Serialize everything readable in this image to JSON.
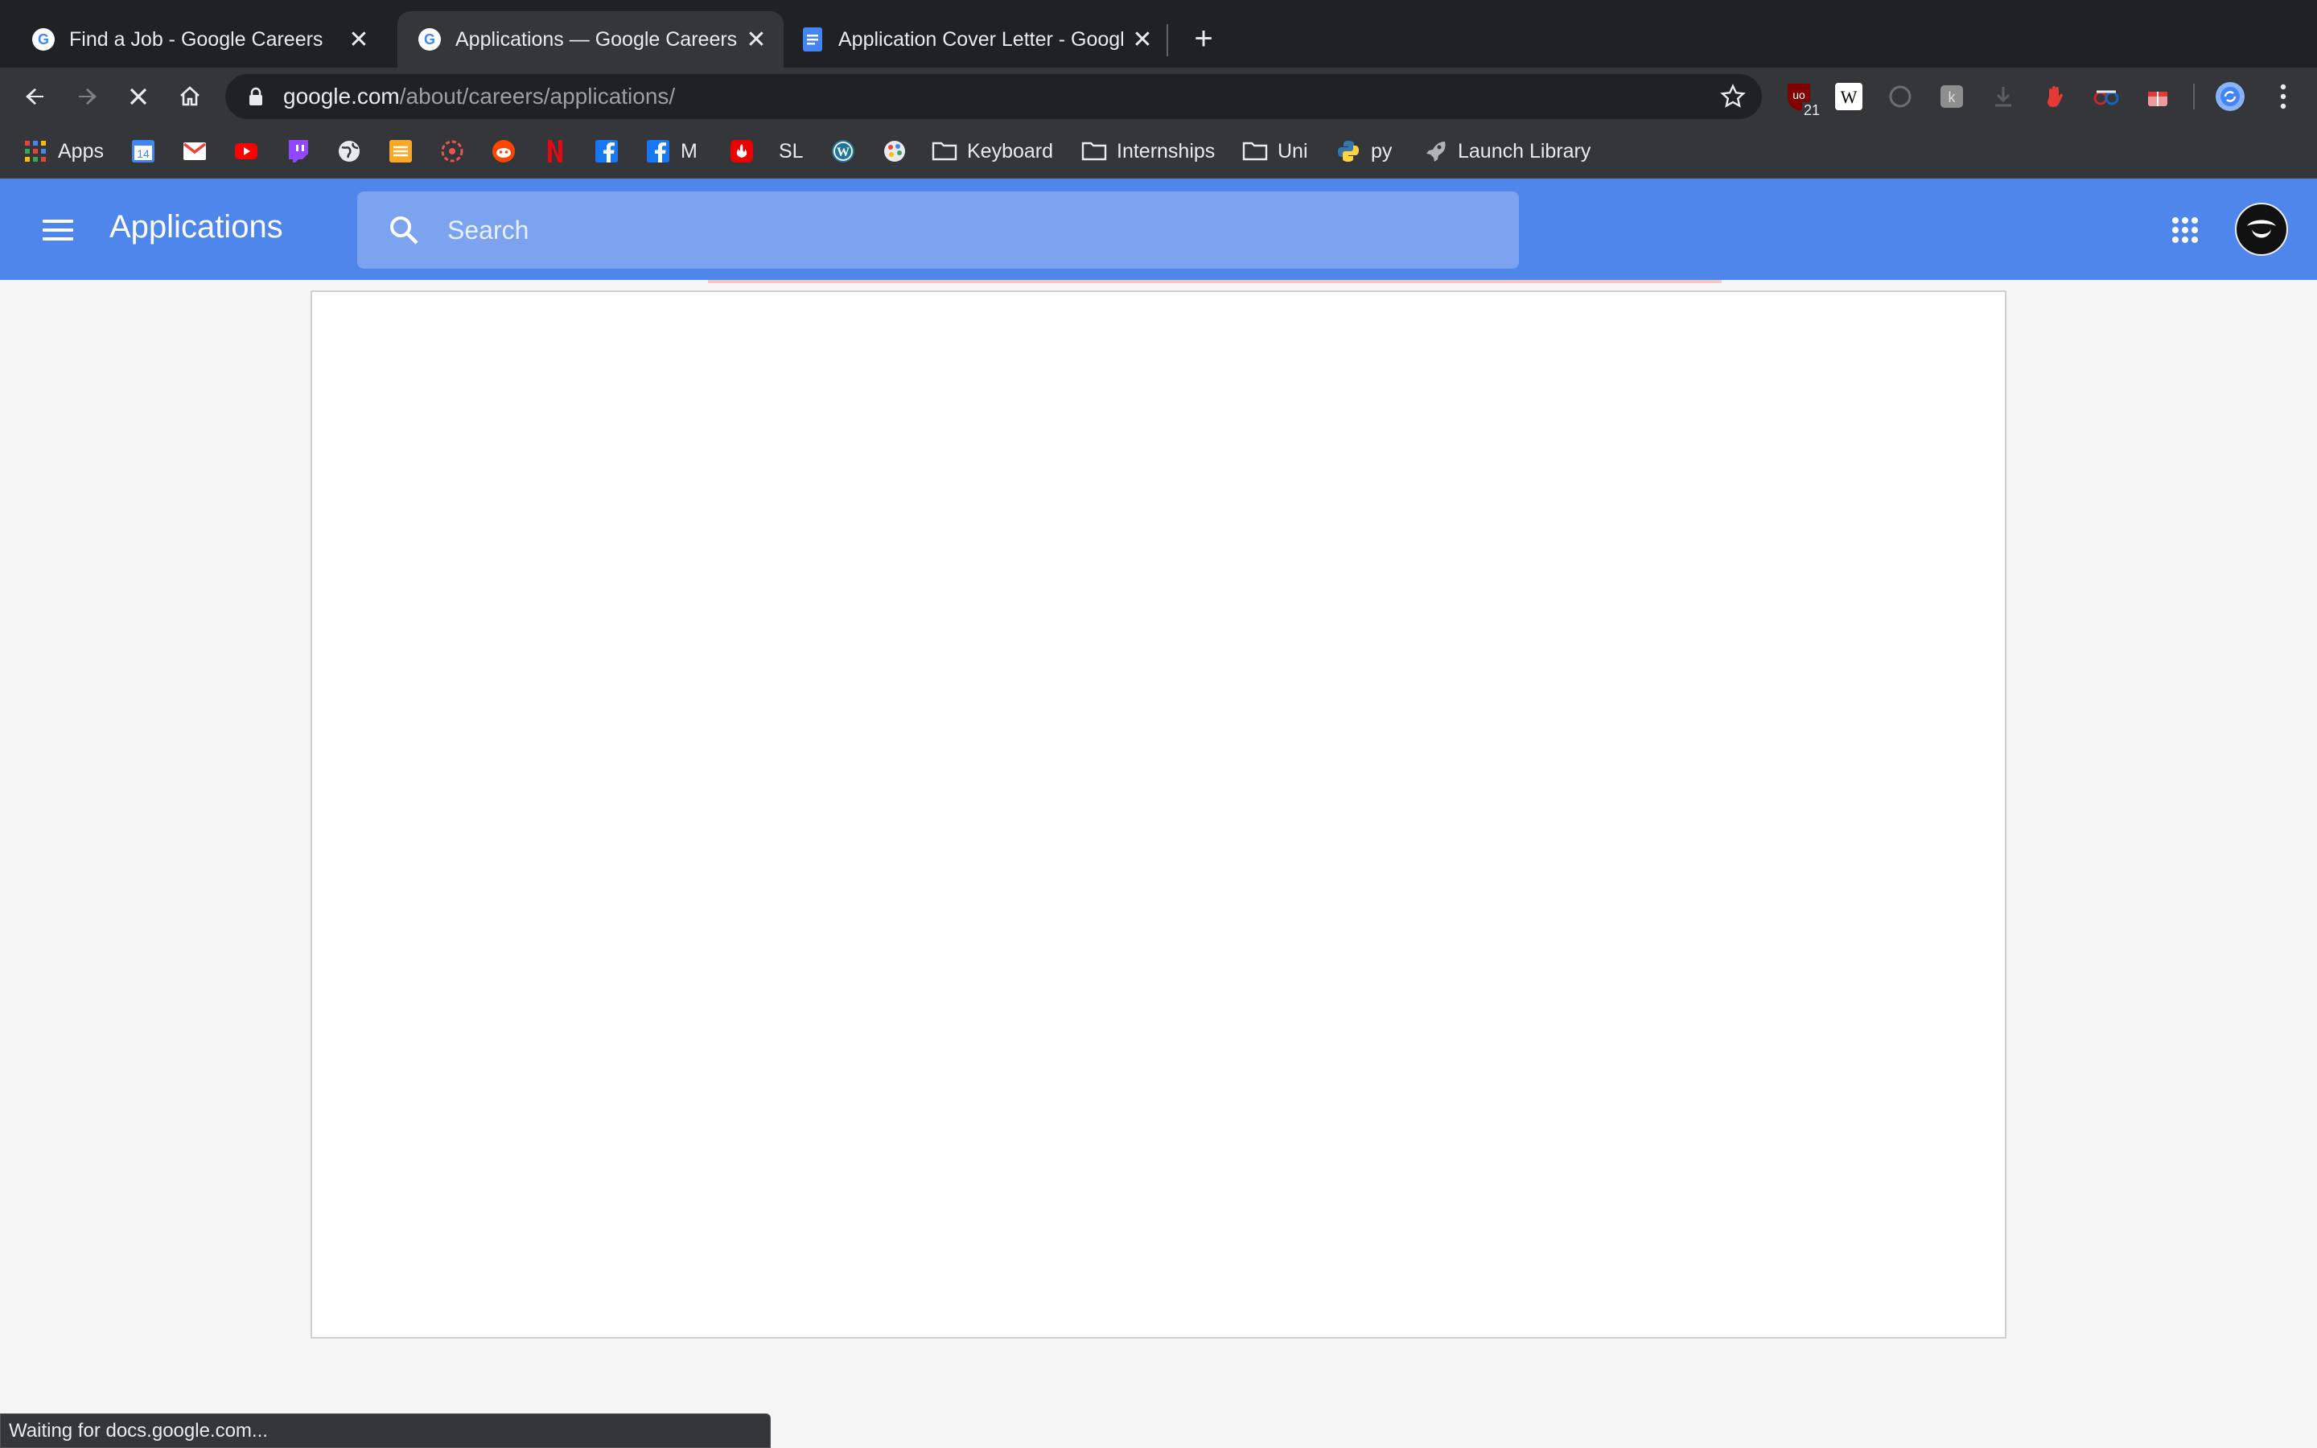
{
  "browser": {
    "tabs": [
      {
        "title": "Find a Job - Google Careers",
        "active": false
      },
      {
        "title": "Applications — Google Careers",
        "active": true
      },
      {
        "title": "Application Cover Letter - Googl",
        "active": false
      }
    ],
    "url_host": "google.com",
    "url_path": "/about/careers/applications/",
    "extension_badge": "21",
    "bookmarks": {
      "apps": "Apps",
      "calendar_day": "14",
      "medium": "M",
      "sl": "SL",
      "keyboard": "Keyboard",
      "internships": "Internships",
      "uni": "Uni",
      "py": "py",
      "launch_library": "Launch Library"
    }
  },
  "page": {
    "title": "Applications",
    "search_placeholder": "Search"
  },
  "status": "Waiting for docs.google.com...",
  "colors": {
    "app_bar": "#4f86ec",
    "search_box": "#7ba3f0",
    "chrome_dark": "#202124",
    "chrome_toolbar": "#35363a"
  }
}
